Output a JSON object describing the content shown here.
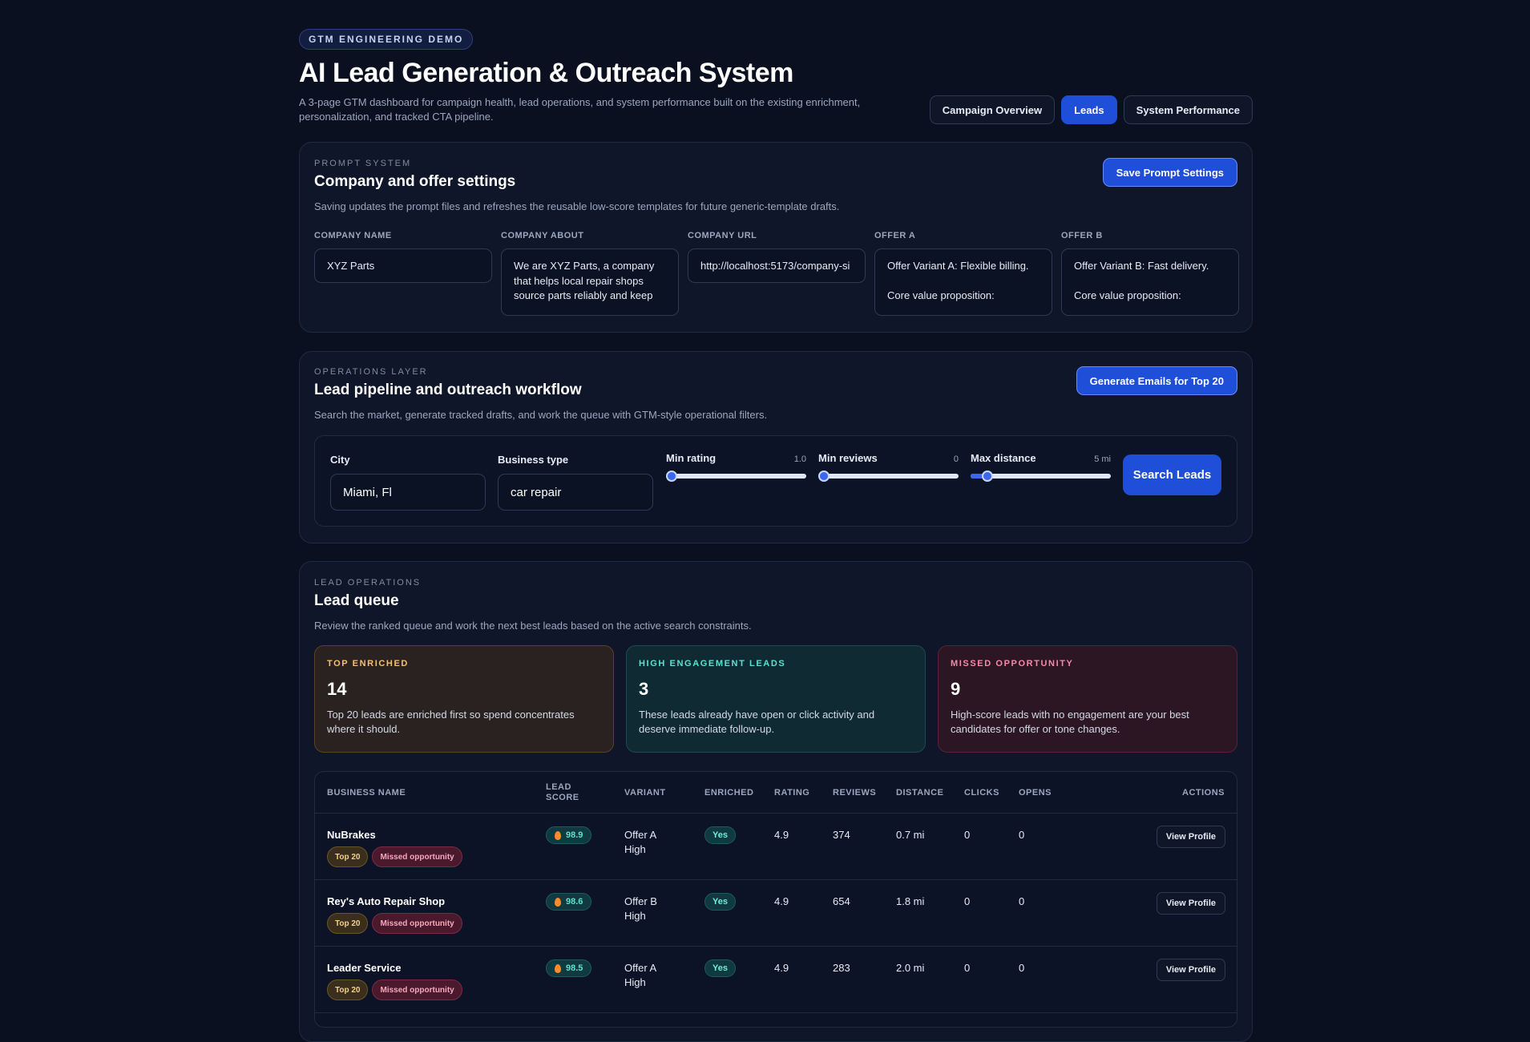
{
  "header": {
    "eyebrow": "GTM ENGINEERING DEMO",
    "title": "AI Lead Generation & Outreach System",
    "subtitle": "A 3-page GTM dashboard for campaign health, lead operations, and system performance built on the existing enrichment, personalization, and tracked CTA pipeline."
  },
  "nav": {
    "tabs": [
      "Campaign Overview",
      "Leads",
      "System Performance"
    ],
    "active": "Leads"
  },
  "prompt_system": {
    "kicker": "PROMPT SYSTEM",
    "title": "Company and offer settings",
    "description": "Saving updates the prompt files and refreshes the reusable low-score templates for future generic-template drafts.",
    "save_label": "Save Prompt Settings",
    "fields": [
      {
        "label": "COMPANY NAME",
        "value": "XYZ Parts"
      },
      {
        "label": "COMPANY ABOUT",
        "value": "We are XYZ Parts, a company that helps local repair shops source parts reliably and keep"
      },
      {
        "label": "COMPANY URL",
        "value": "http://localhost:5173/company-si"
      },
      {
        "label": "OFFER A",
        "value": "Offer Variant A: Flexible billing.\n\nCore value proposition:"
      },
      {
        "label": "OFFER B",
        "value": "Offer Variant B: Fast delivery.\n\nCore value proposition:"
      }
    ]
  },
  "operations": {
    "kicker": "OPERATIONS LAYER",
    "title": "Lead pipeline and outreach workflow",
    "description": "Search the market, generate tracked drafts, and work the queue with GTM-style operational filters.",
    "generate_label": "Generate Emails for Top 20",
    "filters": {
      "city_label": "City",
      "city_value": "Miami, Fl",
      "business_label": "Business type",
      "business_value": "car repair",
      "min_rating_label": "Min rating",
      "min_rating_value": "1.0",
      "min_rating_fraction": 0.0,
      "min_reviews_label": "Min reviews",
      "min_reviews_value": "0",
      "min_reviews_fraction": 0.0,
      "max_distance_label": "Max distance",
      "max_distance_value": "5 mi",
      "max_distance_fraction": 0.12,
      "search_label": "Search Leads"
    }
  },
  "lead_queue": {
    "kicker": "LEAD OPERATIONS",
    "title": "Lead queue",
    "description": "Review the ranked queue and work the next best leads based on the active search constraints.",
    "stats": [
      {
        "kicker": "TOP ENRICHED",
        "value": "14",
        "desc": "Top 20 leads are enriched first so spend concentrates where it should."
      },
      {
        "kicker": "HIGH ENGAGEMENT LEADS",
        "value": "3",
        "desc": "These leads already have open or click activity and deserve immediate follow-up."
      },
      {
        "kicker": "MISSED OPPORTUNITY",
        "value": "9",
        "desc": "High-score leads with no engagement are your best candidates for offer or tone changes."
      }
    ],
    "columns": {
      "business": "BUSINESS NAME",
      "score_1": "LEAD",
      "score_2": "SCORE",
      "variant": "VARIANT",
      "enriched": "ENRICHED",
      "rating": "RATING",
      "reviews": "REVIEWS",
      "distance": "DISTANCE",
      "clicks": "CLICKS",
      "opens": "OPENS",
      "actions": "ACTIONS"
    },
    "rows": [
      {
        "name": "NuBrakes",
        "tag1": "Top 20",
        "tag2": "Missed opportunity",
        "score": "98.9",
        "variant_1": "Offer A",
        "variant_2": "High",
        "enriched": "Yes",
        "rating": "4.9",
        "reviews": "374",
        "distance": "0.7 mi",
        "clicks": "0",
        "opens": "0",
        "action": "View Profile"
      },
      {
        "name": "Rey's Auto Repair Shop",
        "tag1": "Top 20",
        "tag2": "Missed opportunity",
        "score": "98.6",
        "variant_1": "Offer B",
        "variant_2": "High",
        "enriched": "Yes",
        "rating": "4.9",
        "reviews": "654",
        "distance": "1.8 mi",
        "clicks": "0",
        "opens": "0",
        "action": "View Profile"
      },
      {
        "name": "Leader Service",
        "tag1": "Top 20",
        "tag2": "Missed opportunity",
        "score": "98.5",
        "variant_1": "Offer A",
        "variant_2": "High",
        "enriched": "Yes",
        "rating": "4.9",
        "reviews": "283",
        "distance": "2.0 mi",
        "clicks": "0",
        "opens": "0",
        "action": "View Profile"
      }
    ]
  }
}
